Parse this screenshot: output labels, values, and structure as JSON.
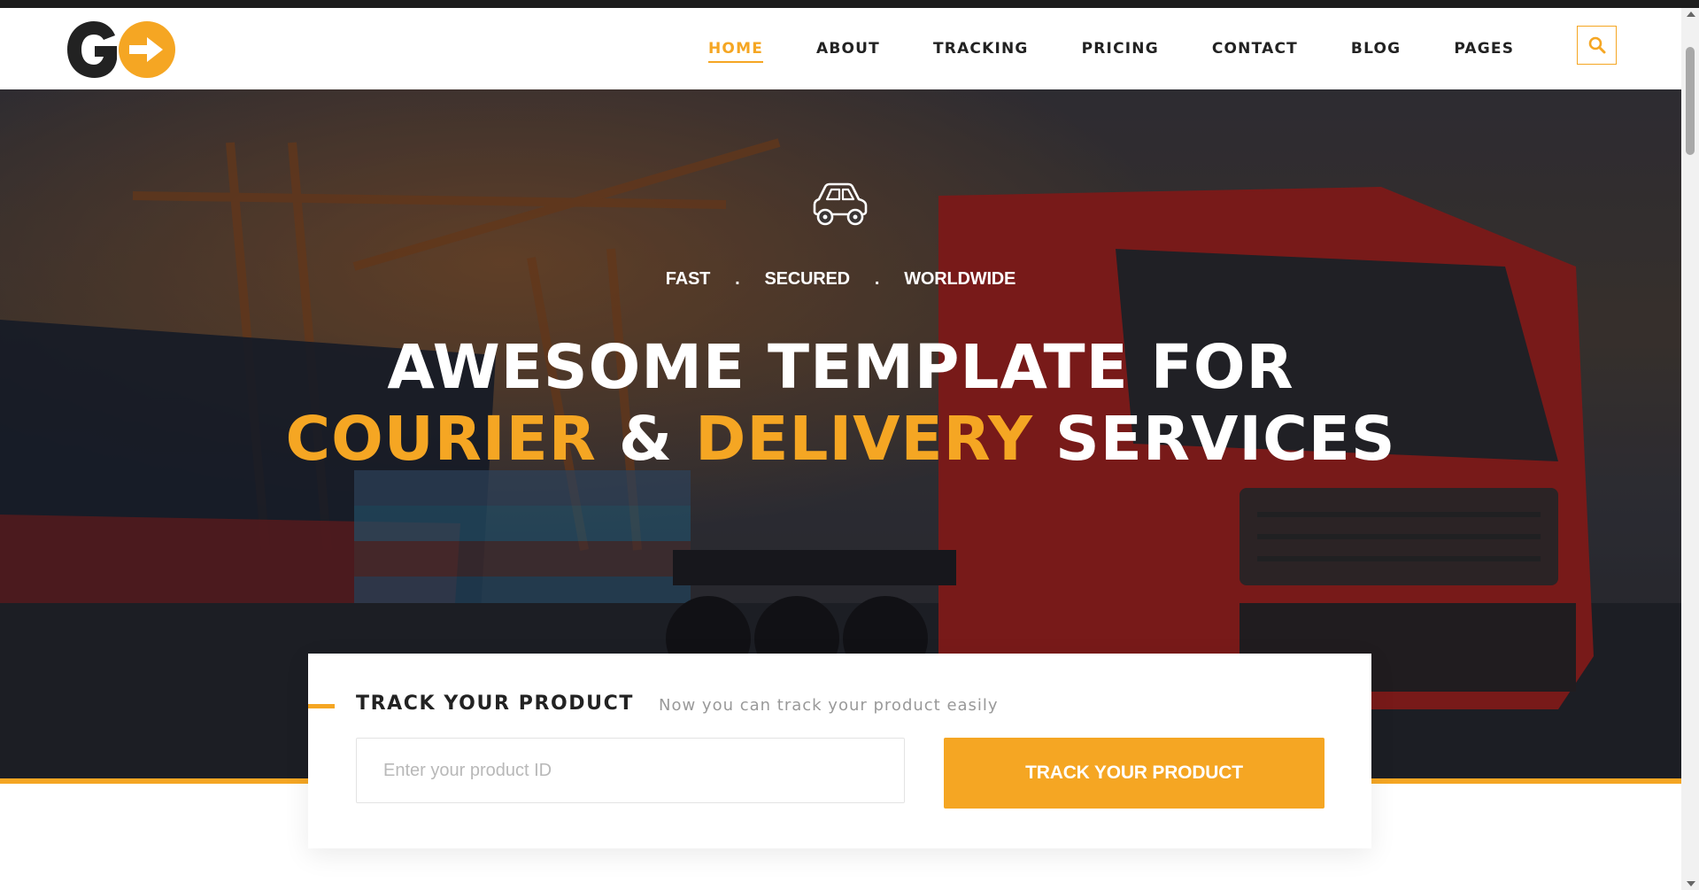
{
  "colors": {
    "accent": "#f5a623",
    "text_dark": "#222222",
    "muted": "#999999"
  },
  "logo": {
    "letter": "G",
    "icon": "arrow-right-icon"
  },
  "nav": {
    "items": [
      {
        "label": "HOME",
        "active": true
      },
      {
        "label": "ABOUT",
        "active": false
      },
      {
        "label": "TRACKING",
        "active": false
      },
      {
        "label": "PRICING",
        "active": false
      },
      {
        "label": "CONTACT",
        "active": false
      },
      {
        "label": "BLOG",
        "active": false
      },
      {
        "label": "PAGES",
        "active": false
      }
    ],
    "search_icon": "search-icon"
  },
  "hero": {
    "icon": "car-icon",
    "tagline": [
      "FAST",
      "SECURED",
      "WORLDWIDE"
    ],
    "tagline_separator": ".",
    "headline_line1": "AWESOME TEMPLATE FOR",
    "headline_line2": {
      "part1": "COURIER",
      "part2": "&",
      "part3": "DELIVERY",
      "part4": "SERVICES"
    }
  },
  "tracking": {
    "title": "TRACK YOUR PRODUCT",
    "subtitle": "Now you can track your product easily",
    "input_placeholder": "Enter your product ID",
    "input_value": "",
    "button_label": "TRACK YOUR PRODUCT"
  }
}
